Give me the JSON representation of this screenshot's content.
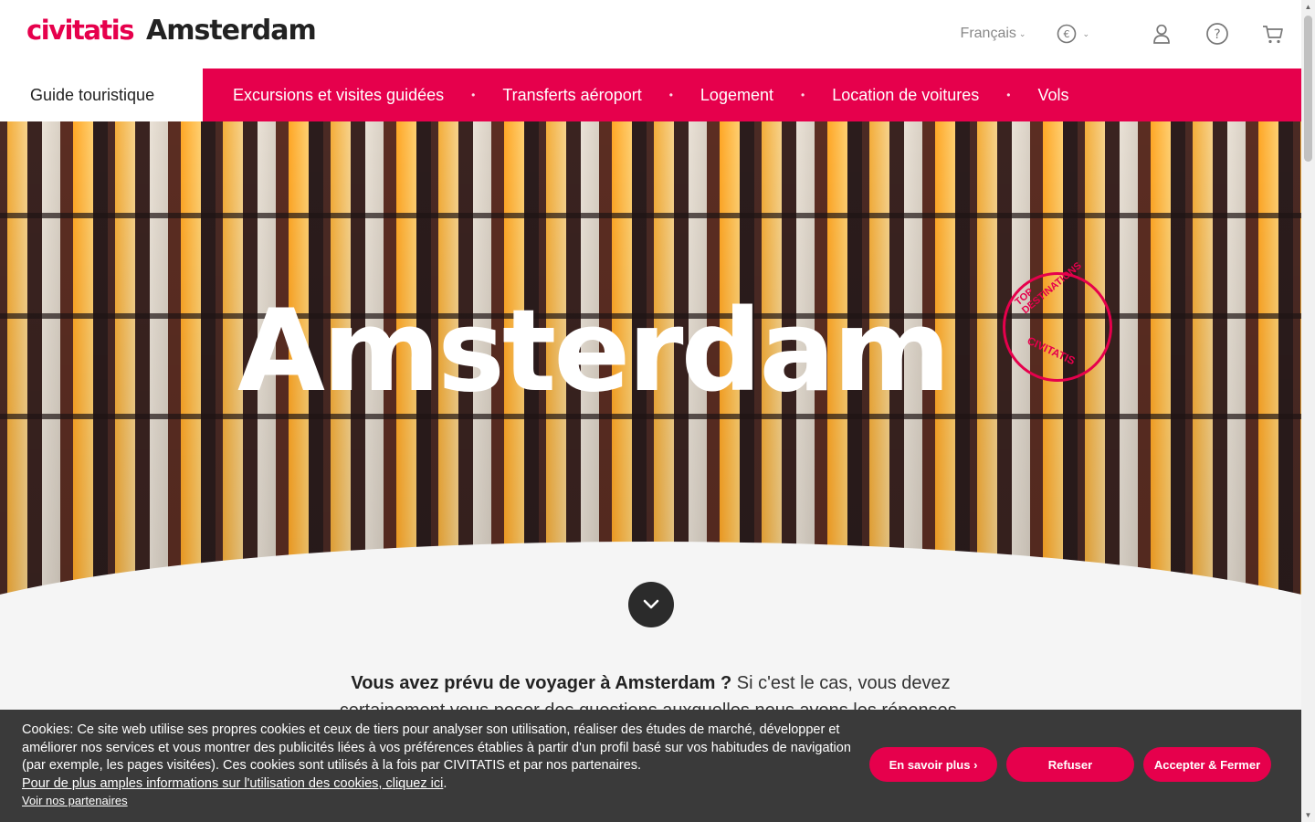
{
  "header": {
    "brand": "civitatis",
    "city": "Amsterdam",
    "language": "Français",
    "currency_symbol": "€"
  },
  "nav": {
    "guide": "Guide touristique",
    "items": [
      "Excursions et visites guidées",
      "Transferts aéroport",
      "Logement",
      "Location de voitures",
      "Vols"
    ]
  },
  "hero": {
    "title": "Amsterdam",
    "stamp_top": "TOP DESTINATIONS",
    "stamp_bottom": "CIVITATIS"
  },
  "intro": {
    "bold": "Vous avez prévu de voyager à Amsterdam ?",
    "rest": " Si c'est le cas, vous devez",
    "line2": "certainement vous poser des questions auxquelles nous avons les réponses."
  },
  "cookie": {
    "text": "Cookies: Ce site web utilise ses propres cookies et ceux de tiers pour analyser son utilisation, réaliser des études de marché, développer et améliorer nos services et vous montrer des publicités liées à vos préférences établies à partir d'un profil basé sur vos habitudes de navigation (par exemple, les pages visitées). Ces cookies sont utilisés à la fois par CIVITATIS et par nos partenaires.",
    "more_info_link": "Pour de plus amples informations sur l'utilisation des cookies, cliquez ici",
    "partners_link": "Voir nos partenaires",
    "btn_more": "En savoir plus ›",
    "btn_refuse": "Refuser",
    "btn_accept": "Accepter & Fermer"
  },
  "colors": {
    "brand": "#e6004c",
    "banner": "#3a3a3a"
  }
}
